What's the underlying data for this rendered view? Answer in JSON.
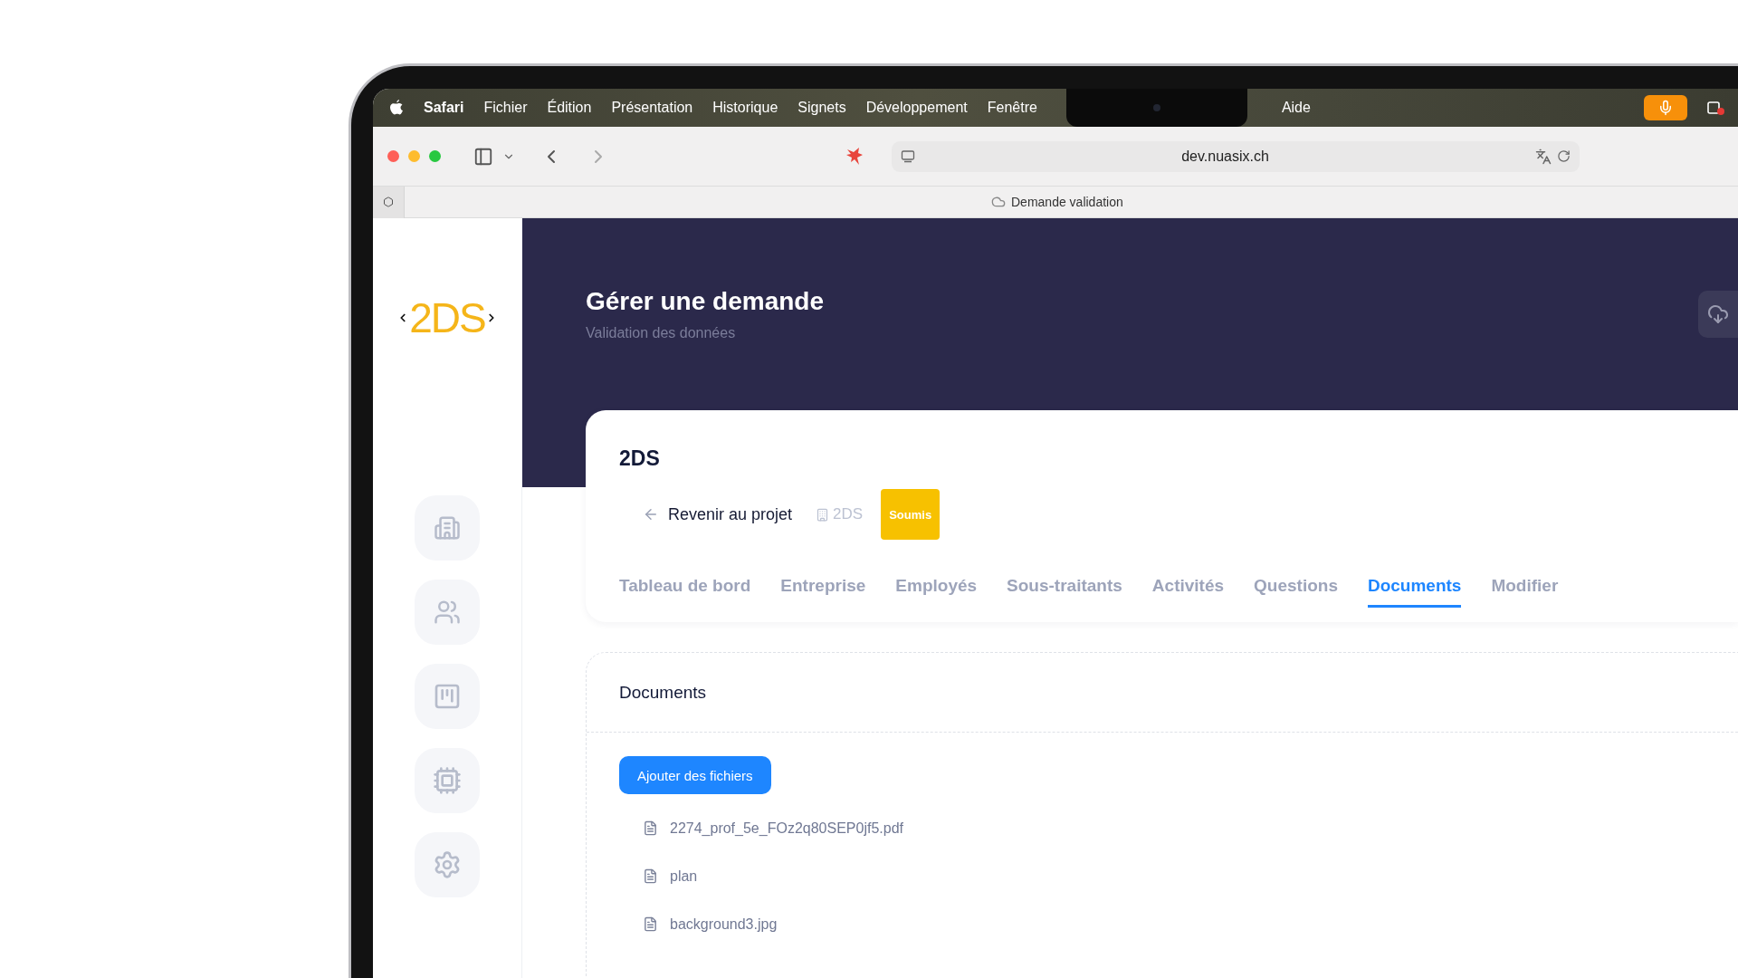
{
  "menu_bar": {
    "app_name": "Safari",
    "menus": [
      "Fichier",
      "Édition",
      "Présentation",
      "Historique",
      "Signets",
      "Développement",
      "Fenêtre"
    ],
    "right_menus": [
      "Aide"
    ]
  },
  "browser": {
    "address": "dev.nuasix.ch",
    "tab_title": "Demande validation"
  },
  "sidebar": {
    "logo": "2DS",
    "items": [
      {
        "kind": "building"
      },
      {
        "kind": "users"
      },
      {
        "kind": "board"
      },
      {
        "kind": "chip"
      },
      {
        "kind": "settings"
      }
    ]
  },
  "header": {
    "title": "Gérer une demande",
    "subtitle": "Validation des données"
  },
  "card": {
    "title": "2DS",
    "back_link": "Revenir au projet",
    "project": "2DS",
    "status": "Soumis",
    "tabs": [
      {
        "label": "Tableau de bord",
        "selected": false
      },
      {
        "label": "Entreprise",
        "selected": false
      },
      {
        "label": "Employés",
        "selected": false
      },
      {
        "label": "Sous-traitants",
        "selected": false
      },
      {
        "label": "Activités",
        "selected": false
      },
      {
        "label": "Questions",
        "selected": false
      },
      {
        "label": "Documents",
        "selected": true
      },
      {
        "label": "Modifier",
        "selected": false
      }
    ]
  },
  "documents": {
    "title": "Documents",
    "add_button": "Ajouter des fichiers",
    "files": [
      "2274_prof_5e_FOz2q80SEP0jf5.pdf",
      "plan",
      "background3.jpg"
    ]
  }
}
